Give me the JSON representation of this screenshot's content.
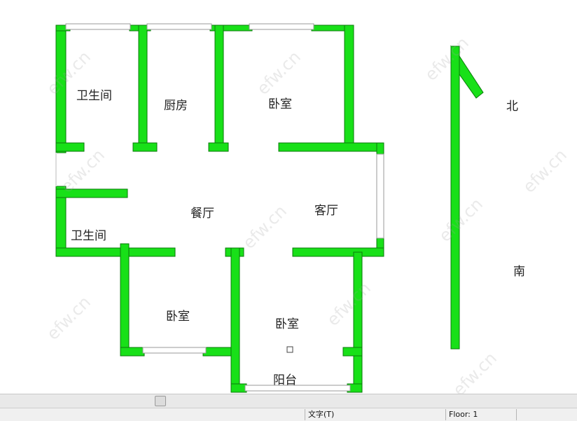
{
  "rooms": {
    "bathroom_top": "卫生间",
    "kitchen": "厨房",
    "bedroom_top": "卧室",
    "dining": "餐厅",
    "living": "客厅",
    "bathroom_mid": "卫生间",
    "bedroom_bottom_left": "卧室",
    "bedroom_bottom_right": "卧室",
    "balcony": "阳台"
  },
  "compass": {
    "north": "北",
    "south": "南"
  },
  "watermark": "efw.cn",
  "statusbar": {
    "mode": "文字(T)",
    "floor": "Floor: 1"
  },
  "colors": {
    "wall": "#18e018",
    "wall_edge": "#0a7a0a",
    "window": "#bdbdbd"
  }
}
